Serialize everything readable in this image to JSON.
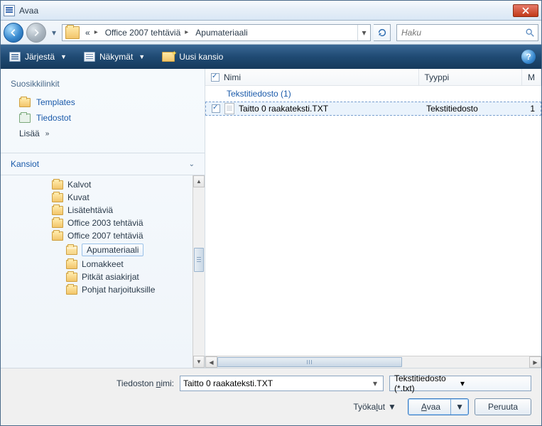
{
  "title": "Avaa",
  "breadcrumb": {
    "root_marker": "«",
    "level1": "Office 2007 tehtäviä",
    "level2": "Apumateriaali"
  },
  "search": {
    "placeholder": "Haku"
  },
  "toolbar": {
    "organize": "Järjestä",
    "views": "Näkymät",
    "newfolder": "Uusi kansio"
  },
  "favorites": {
    "heading": "Suosikkilinkit",
    "items": [
      "Templates",
      "Tiedostot"
    ],
    "more": "Lisää"
  },
  "folders_heading": "Kansiot",
  "tree": [
    "Kalvot",
    "Kuvat",
    "Lisätehtäviä",
    "Office 2003 tehtäviä",
    "Office 2007 tehtäviä",
    "Apumateriaali",
    "Lomakkeet",
    "Pitkät asiakirjat",
    "Pohjat harjoituksille"
  ],
  "columns": {
    "name": "Nimi",
    "type": "Tyyppi",
    "m": "M"
  },
  "group_label": "Tekstitiedosto (1)",
  "file": {
    "name": "Taitto 0 raakateksti.TXT",
    "type": "Tekstitiedosto",
    "extra": "1"
  },
  "footer": {
    "filename_label_pre": "Tiedoston ",
    "filename_label_u": "n",
    "filename_label_post": "imi:",
    "filename_value": "Taitto 0 raakateksti.TXT",
    "filetype": "Tekstitiedosto (*.txt)",
    "tools_pre": "Työka",
    "tools_u": "l",
    "tools_post": "ut",
    "open_u": "A",
    "open_post": "vaa",
    "cancel": "Peruuta"
  }
}
